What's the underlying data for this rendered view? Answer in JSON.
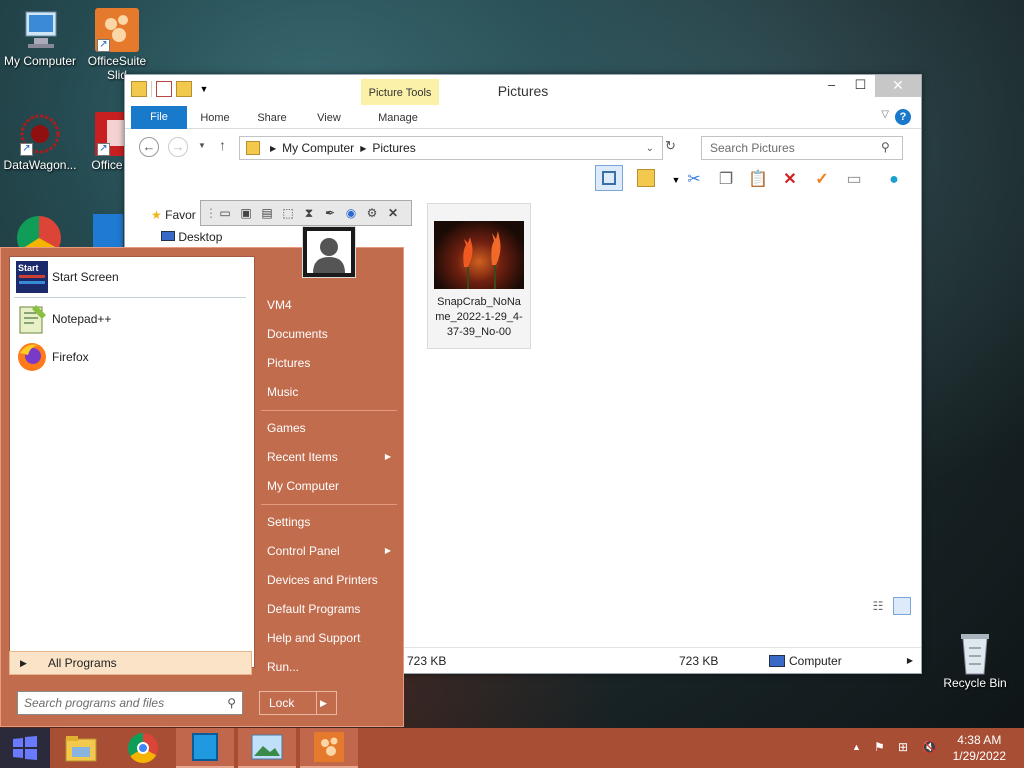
{
  "desktop": {
    "icons": [
      {
        "label": "My Computer",
        "icon": "computer-icon"
      },
      {
        "label": "OfficeSuite Slid",
        "icon": "officesuite-icon"
      },
      {
        "label": "DataWagon...",
        "icon": "datawagon-icon"
      },
      {
        "label": "Office PD",
        "icon": "officepdf-icon"
      },
      {
        "label": "Recycle Bin",
        "icon": "recycle-bin-icon"
      }
    ]
  },
  "explorer": {
    "title": "Pictures",
    "context_tab": "Picture Tools",
    "tabs": [
      "File",
      "Home",
      "Share",
      "View",
      "Manage"
    ],
    "address": [
      "My Computer",
      "Pictures"
    ],
    "search_placeholder": "Search Pictures",
    "nav": {
      "favorites": "Favor",
      "desktop": "Desktop"
    },
    "file": {
      "name": "SnapCrab_NoNa\nme_2022-1-29_4-\n37-39_No-00"
    },
    "status": {
      "left_size": "723 KB",
      "mid_size": "723 KB",
      "location": "Computer"
    }
  },
  "startmenu": {
    "programs": [
      {
        "label": "Start Screen",
        "icon": "start-screen-icon"
      },
      {
        "label": "Notepad++",
        "icon": "notepadpp-icon"
      },
      {
        "label": "Firefox",
        "icon": "firefox-icon"
      }
    ],
    "all_programs": "All Programs",
    "search_placeholder": "Search programs and files",
    "right_items": [
      "VM4",
      "Documents",
      "Pictures",
      "Music",
      "Games",
      "Recent Items",
      "My Computer",
      "Settings",
      "Control Panel",
      "Devices and Printers",
      "Default Programs",
      "Help and Support",
      "Run..."
    ],
    "lock_label": "Lock",
    "start_screen_tile": "Start"
  },
  "taskbar": {
    "time": "4:38 AM",
    "date": "1/29/2022"
  }
}
